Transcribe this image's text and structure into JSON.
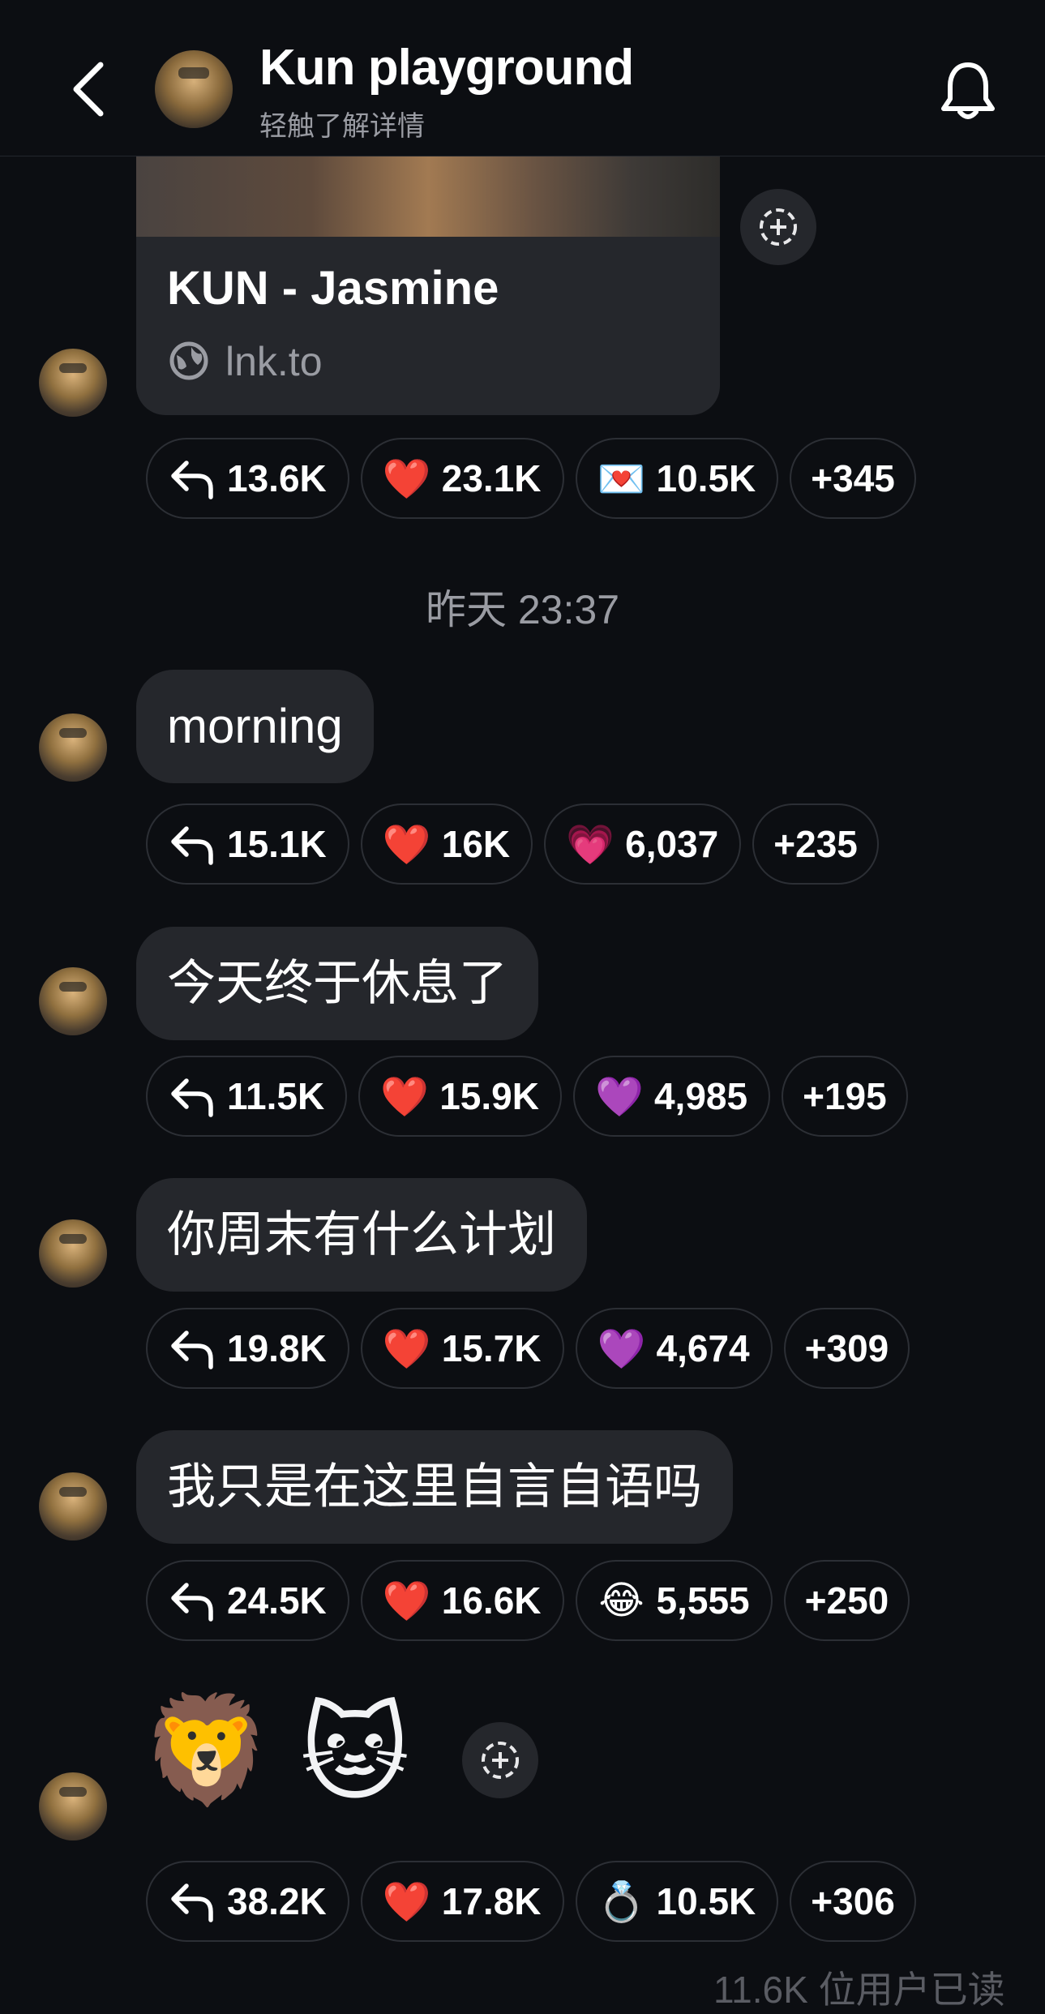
{
  "header": {
    "title": "Kun playground",
    "subtitle": "轻触了解详情"
  },
  "link_card": {
    "title": "KUN - Jasmine",
    "domain": "lnk.to"
  },
  "timestamp": "昨天 23:37",
  "messages": [
    {
      "text": "morning"
    },
    {
      "text": "今天终于休息了"
    },
    {
      "text": "你周末有什么计划"
    },
    {
      "text": "我只是在这里自言自语吗"
    },
    {
      "emojis": [
        "🦁",
        "🐱"
      ]
    }
  ],
  "reactions": [
    {
      "reply": "13.6K",
      "heart": "23.1K",
      "third_icon": "💌",
      "third": "10.5K",
      "more": "+345"
    },
    {
      "reply": "15.1K",
      "heart": "16K",
      "third_icon": "💗",
      "third": "6,037",
      "more": "+235"
    },
    {
      "reply": "11.5K",
      "heart": "15.9K",
      "third_icon": "💜",
      "third": "4,985",
      "more": "+195"
    },
    {
      "reply": "19.8K",
      "heart": "15.7K",
      "third_icon": "💜",
      "third": "4,674",
      "more": "+309"
    },
    {
      "reply": "24.5K",
      "heart": "16.6K",
      "third_icon": "😂",
      "third": "5,555",
      "more": "+250"
    },
    {
      "reply": "38.2K",
      "heart": "17.8K",
      "third_icon": "💍",
      "third": "10.5K",
      "more": "+306"
    }
  ],
  "heart_icon": "❤️",
  "footer_partial": "11.6K 位用户已读",
  "colors": {
    "background": "#0c0e12",
    "bubble": "#25272c",
    "muted": "#9a9ca3"
  }
}
